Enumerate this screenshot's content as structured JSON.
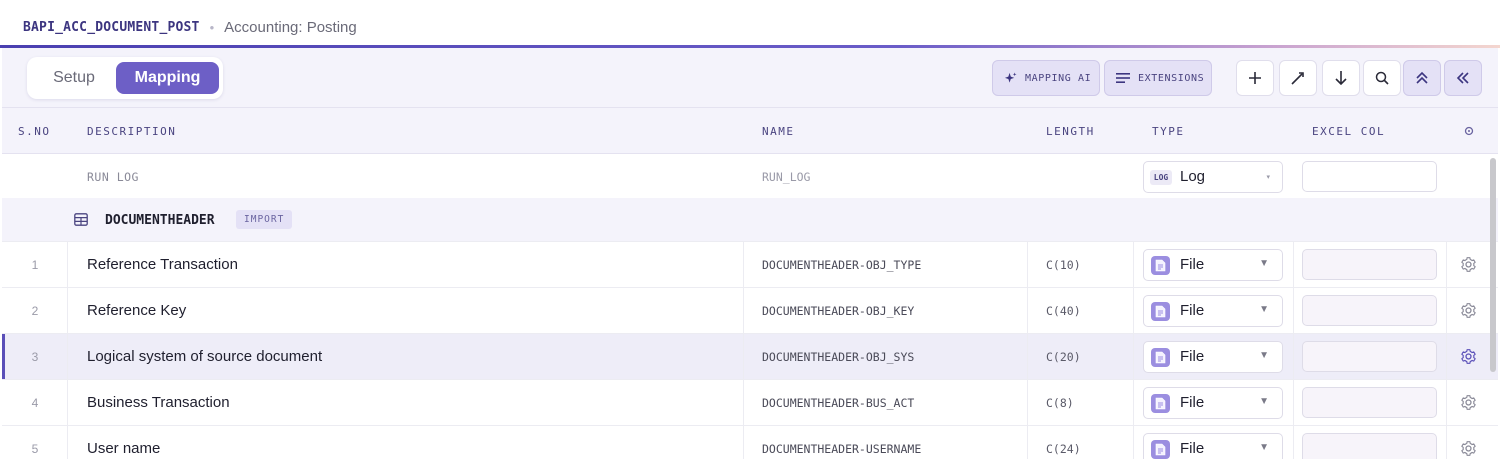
{
  "header": {
    "title": "BAPI_ACC_DOCUMENT_POST",
    "separator": "•",
    "subtitle": "Accounting: Posting"
  },
  "tabs": [
    {
      "label": "Setup",
      "active": false
    },
    {
      "label": "Mapping",
      "active": true
    }
  ],
  "toolbar": {
    "mapping_ai_label": "MAPPING AI",
    "extensions_label": "EXTENSIONS",
    "icons": [
      "plus-icon",
      "magic-wand-icon",
      "arrow-down-icon",
      "search-icon",
      "chevrons-up-icon",
      "chevrons-left-icon"
    ]
  },
  "columns": {
    "sno": "S.NO",
    "description": "DESCRIPTION",
    "name": "NAME",
    "length": "LENGTH",
    "type": "TYPE",
    "excel_col": "EXCEL COL"
  },
  "run_log": {
    "description": "RUN LOG",
    "name": "RUN_LOG",
    "type_tag": "LOG",
    "type": "Log",
    "caret": "▾",
    "excel_col": ""
  },
  "section": {
    "title": "DOCUMENTHEADER",
    "badge": "IMPORT"
  },
  "rows": [
    {
      "sno": "1",
      "description": "Reference Transaction",
      "name": "DOCUMENTHEADER-OBJ_TYPE",
      "length": "C(10)",
      "type": "File",
      "caret": "▼",
      "excel_col": ""
    },
    {
      "sno": "2",
      "description": "Reference Key",
      "name": "DOCUMENTHEADER-OBJ_KEY",
      "length": "C(40)",
      "type": "File",
      "caret": "▼",
      "excel_col": ""
    },
    {
      "sno": "3",
      "description": "Logical system of source document",
      "name": "DOCUMENTHEADER-OBJ_SYS",
      "length": "C(20)",
      "type": "File",
      "caret": "▼",
      "excel_col": "",
      "selected": true
    },
    {
      "sno": "4",
      "description": "Business Transaction",
      "name": "DOCUMENTHEADER-BUS_ACT",
      "length": "C(8)",
      "type": "File",
      "caret": "▼",
      "excel_col": ""
    },
    {
      "sno": "5",
      "description": "User name",
      "name": "DOCUMENTHEADER-USERNAME",
      "length": "C(24)",
      "type": "File",
      "caret": "▼",
      "excel_col": ""
    }
  ],
  "colors": {
    "accent": "#6d5fc6",
    "accent_dark": "#3c3580",
    "header_bg": "#f4f3fb",
    "selected_row": "#eeedf8"
  }
}
